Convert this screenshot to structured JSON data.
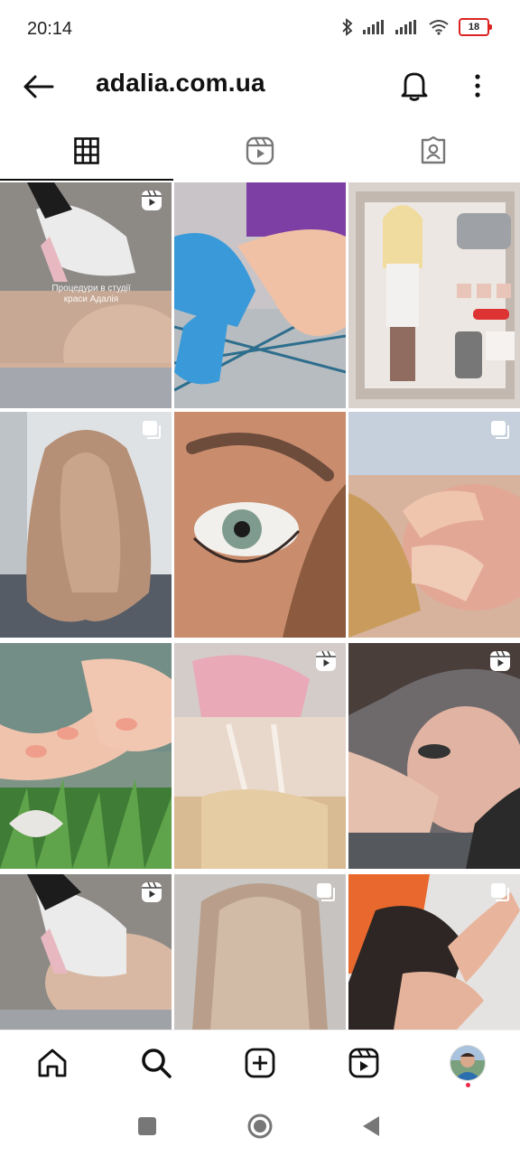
{
  "status_bar": {
    "time": "20:14",
    "battery": "18"
  },
  "header": {
    "title": "adalia.com.ua"
  },
  "tabs": [
    {
      "name": "grid",
      "active": true
    },
    {
      "name": "reels",
      "active": false
    },
    {
      "name": "tagged",
      "active": false
    }
  ],
  "posts": [
    {
      "type": "reel",
      "overlay_text": "Процедури в студії краси Адалія"
    },
    {
      "type": "photo"
    },
    {
      "type": "photo"
    },
    {
      "type": "carousel"
    },
    {
      "type": "photo"
    },
    {
      "type": "carousel"
    },
    {
      "type": "photo"
    },
    {
      "type": "reel"
    },
    {
      "type": "reel"
    },
    {
      "type": "reel"
    },
    {
      "type": "carousel"
    },
    {
      "type": "carousel"
    }
  ],
  "bottom_nav": [
    "home",
    "search",
    "create",
    "reels",
    "profile"
  ],
  "colors": {
    "accent": "#111111",
    "notify": "#f02849",
    "battery_low": "#dd2222"
  }
}
